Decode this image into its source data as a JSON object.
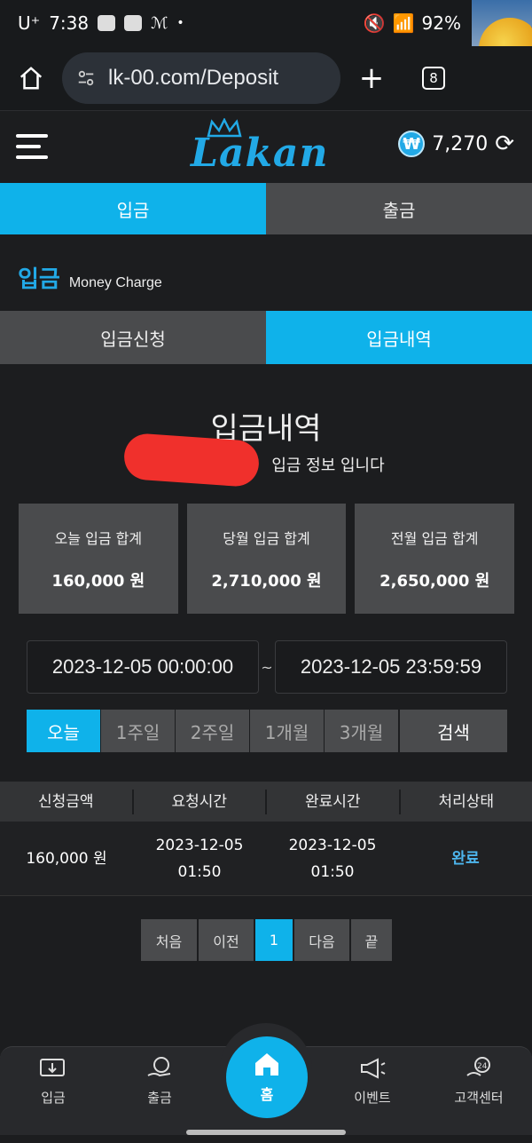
{
  "status_bar": {
    "carrier": "U⁺",
    "time": "7:38",
    "battery": "92%"
  },
  "browser": {
    "url": "lk-00.com/Deposit",
    "tab_count": "8"
  },
  "header": {
    "logo": "Lakan",
    "balance": "7,270",
    "currency_symbol": "₩"
  },
  "main_tabs": [
    {
      "label": "입금"
    },
    {
      "label": "출금"
    }
  ],
  "section": {
    "title_ko": "입금",
    "title_en": "Money Charge"
  },
  "sub_tabs": [
    {
      "label": "입금신청"
    },
    {
      "label": "입금내역"
    }
  ],
  "history": {
    "title": "입금내역",
    "info_suffix": "입금 정보 입니다"
  },
  "summary": [
    {
      "label": "오늘 입금 합계",
      "value": "160,000 원"
    },
    {
      "label": "당월 입금 합계",
      "value": "2,710,000 원"
    },
    {
      "label": "전월 입금 합계",
      "value": "2,650,000 원"
    }
  ],
  "date_range": {
    "from": "2023-12-05 00:00:00",
    "separator": "~",
    "to": "2023-12-05 23:59:59"
  },
  "periods": [
    "오늘",
    "1주일",
    "2주일",
    "1개월",
    "3개월"
  ],
  "search_label": "검색",
  "table": {
    "headers": [
      "신청금액",
      "요청시간",
      "완료시간",
      "처리상태"
    ],
    "rows": [
      {
        "amount": "160,000 원",
        "request_date": "2023-12-05",
        "request_time": "01:50",
        "complete_date": "2023-12-05",
        "complete_time": "01:50",
        "status": "완료"
      }
    ]
  },
  "pager": {
    "first": "처음",
    "prev": "이전",
    "current": "1",
    "next": "다음",
    "last": "끝"
  },
  "bottom_nav": [
    {
      "label": "입금"
    },
    {
      "label": "출금"
    },
    {
      "label": "홈"
    },
    {
      "label": "이벤트"
    },
    {
      "label": "고객센터"
    }
  ],
  "colors": {
    "accent": "#0fb2ea",
    "tab_inactive": "#4a4b4d",
    "background": "#1c1d1f",
    "status_done": "#4db6ee"
  }
}
